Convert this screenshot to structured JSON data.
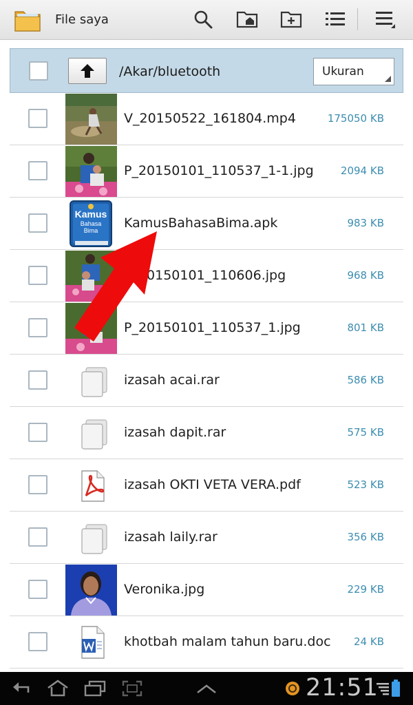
{
  "app": {
    "title": "File saya",
    "folder_icon": "folder-icon",
    "actions": [
      "search-icon",
      "home-folder-icon",
      "new-folder-icon",
      "list-view-icon",
      "menu-icon"
    ]
  },
  "path": {
    "current": "/Akar/bluetooth",
    "up_icon": "up-arrow-icon",
    "sort_value": "Ukuran"
  },
  "files": [
    {
      "name": "V_20150522_161804.mp4",
      "size": "175050 KB",
      "icon": "video-thumbnail"
    },
    {
      "name": "P_20150101_110537_1-1.jpg",
      "size": "2094 KB",
      "icon": "photo-thumbnail"
    },
    {
      "name": "KamusBahasaBima.apk",
      "size": "983 KB",
      "icon": "apk-icon",
      "apk_label_1": "Kamus",
      "apk_label_2": "Bahasa",
      "apk_label_3": "Bima"
    },
    {
      "name": "P_20150101_110606.jpg",
      "size": "968 KB",
      "icon": "photo-thumbnail"
    },
    {
      "name": "P_20150101_110537_1.jpg",
      "size": "801 KB",
      "icon": "photo-thumbnail"
    },
    {
      "name": "izasah acai.rar",
      "size": "586 KB",
      "icon": "archive-icon"
    },
    {
      "name": "izasah dapit.rar",
      "size": "575 KB",
      "icon": "archive-icon"
    },
    {
      "name": "izasah OKTI VETA VERA.pdf",
      "size": "523 KB",
      "icon": "pdf-icon"
    },
    {
      "name": "izasah laily.rar",
      "size": "356 KB",
      "icon": "archive-icon"
    },
    {
      "name": "Veronika.jpg",
      "size": "229 KB",
      "icon": "photo-thumbnail"
    },
    {
      "name": "khotbah malam tahun baru.doc",
      "size": "24 KB",
      "icon": "word-doc-icon"
    }
  ],
  "status": {
    "time": "21:51",
    "icons": [
      "back-icon",
      "home-icon",
      "recent-apps-icon",
      "screenshot-icon",
      "expand-up-icon",
      "sync-icon",
      "signal-icon",
      "battery-icon"
    ]
  },
  "colors": {
    "path_bar": "#c4d9e7",
    "size_text": "#3c8db0",
    "annotation_arrow": "#ee0b0b"
  }
}
